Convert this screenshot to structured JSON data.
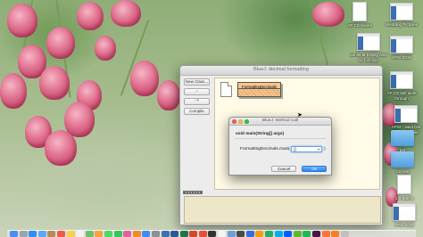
{
  "desktop": {
    "icons": [
      {
        "label": "AP CS teams",
        "kind": "doc"
      },
      {
        "label": "Wedding Pictures",
        "kind": "thumb"
      },
      {
        "label": "Limits at Infinity also w/ function",
        "kind": "thumb"
      },
      {
        "label": "APSI 2016",
        "kind": "thumb"
      },
      {
        "label": "AP CS self work through",
        "kind": "thumb"
      },
      {
        "label": "APSI - Java Det Flash Equals",
        "kind": "thumb"
      },
      {
        "label": "pet",
        "kind": "folder"
      },
      {
        "label": "CS test",
        "kind": "folder"
      },
      {
        "label": "1-2 teams",
        "kind": "thumb"
      },
      {
        "label": "APSI 2016",
        "kind": "thumb"
      }
    ]
  },
  "bluej": {
    "window_title": "BlueJ: decimal formatting",
    "toolbar": {
      "new_class": "New Class...",
      "arrow_uses": "→",
      "arrow_inherits": "⇢",
      "compile": "Compile"
    },
    "class_name": "FormattingDecimals"
  },
  "dialog": {
    "title": "BlueJ: Method Call",
    "signature": "void main(String[] args)",
    "call_prefix": "FormattingDecimals.main",
    "paren_open": "(",
    "paren_close": ")",
    "arg_value": "{}",
    "cancel_label": "Cancel",
    "ok_label": "Ok"
  },
  "dock": {
    "apps": [
      "finder",
      "launchpad",
      "safari",
      "mail",
      "contacts",
      "calendar",
      "notes",
      "reminders",
      "maps",
      "photos",
      "messages",
      "facetime",
      "itunes",
      "ibooks",
      "appstore",
      "preferences",
      "bluej",
      "word",
      "excel",
      "powerpoint",
      "chrome",
      "terminal",
      "textedit",
      "preview",
      "quicktime",
      "keynote",
      "pages",
      "numbers",
      "skype",
      "dropbox",
      "evernote",
      "spotify",
      "slack",
      "firefox",
      "vlc",
      "trash"
    ],
    "colors": [
      "#4a8fe7",
      "#9aa4ad",
      "#2d8ff0",
      "#5aa9f5",
      "#b78a5e",
      "#f05a4a",
      "#f5d34a",
      "#f2f2f2",
      "#6fbf6a",
      "#f5a33a",
      "#4cd964",
      "#34c759",
      "#e85d9c",
      "#f08a2a",
      "#3b8ef2",
      "#8e8e93",
      "#3e6fb5",
      "#2b579a",
      "#217346",
      "#d24726",
      "#e94b3c",
      "#333333",
      "#f3f3f3",
      "#6a9fd8",
      "#4a4a4a",
      "#2f6fe0",
      "#f39c12",
      "#27ae60",
      "#00aff0",
      "#0061fe",
      "#5fb832",
      "#1db954",
      "#4a154b",
      "#ff7139",
      "#f48120",
      "#c0c0c0"
    ]
  }
}
